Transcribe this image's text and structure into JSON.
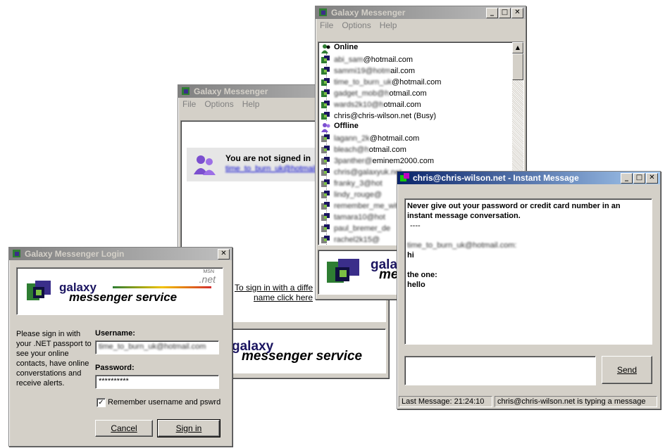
{
  "colors": {
    "title_active": "#0a246a",
    "title_inactive": "#808080",
    "window_face": "#d4d0c8",
    "logo_green": "#2e7d32",
    "logo_purple": "#3a2e8a",
    "link_blue": "#0000cc"
  },
  "main_window": {
    "title": "Galaxy Messenger",
    "menu": [
      "File",
      "Options",
      "Help"
    ],
    "not_signed_in_text": "You are not signed in",
    "signed_in_email_blurred": "time_to_burn_uk@hotmail.com",
    "sign_in_different_line1": "To sign in with a diffe",
    "sign_in_different_line2": "name click here",
    "logo_word1": "galaxy",
    "logo_word2": "messenger service"
  },
  "contacts_window": {
    "title": "Galaxy Messenger",
    "menu": [
      "File",
      "Options",
      "Help"
    ],
    "online_label": "Online",
    "offline_label": "Offline",
    "online": [
      {
        "pre": "abi_sam",
        "post": "@hotmail.com"
      },
      {
        "pre": "sammi19@hotm",
        "post": "ail.com"
      },
      {
        "pre": "time_to_burn_uk",
        "post": "@hotmail.com"
      },
      {
        "pre": "gadget_mob@h",
        "post": "otmail.com"
      },
      {
        "pre": "wards2k10@h",
        "post": "otmail.com"
      },
      {
        "pre": "",
        "post": "chris@chris-wilson.net (Busy)"
      }
    ],
    "offline": [
      {
        "pre": "lagann_2k",
        "post": "@hotmail.com"
      },
      {
        "pre": "bleach@h",
        "post": "otmail.com"
      },
      {
        "pre": "3panther@",
        "post": "eminem2000.com"
      },
      {
        "pre": "chris@galaxyuk.net",
        "post": ""
      },
      {
        "pre": "franky_3@hot",
        "post": ""
      },
      {
        "pre": "lindy_rouge@",
        "post": ""
      },
      {
        "pre": "remember_me_with",
        "post": ""
      },
      {
        "pre": "tamara10@hot",
        "post": ""
      },
      {
        "pre": "paul_bremer_de",
        "post": ""
      },
      {
        "pre": "rachel2k15@",
        "post": ""
      }
    ],
    "logo_word1": "gala",
    "logo_word2": "me"
  },
  "login_window": {
    "title": "Galaxy Messenger Login",
    "close": "✕",
    "net_badge": ".net",
    "net_small": "MSN",
    "logo_word1": "galaxy",
    "logo_word2": "messenger service",
    "info_text": "Please sign in with your .NET passport to see your online contacts,  have online converstations and receive alerts.",
    "username_label": "Username:",
    "username_value": "time_to_burn_uk@hotmail.com",
    "password_label": "Password:",
    "password_value": "**********",
    "remember_label": "Remember username and pswrd",
    "remember_checked": true,
    "cancel_label": "Cancel",
    "signin_label": "Sign in"
  },
  "im_window": {
    "title": "chris@chris-wilson.net - Instant Message",
    "warning": "Never give out your password or credit card number in an instant message conversation.",
    "separator": "----",
    "msg1_sender": "time_to_burn_uk@hotmail.com:",
    "msg1_text": "hi",
    "msg2_sender": "the one:",
    "msg2_text": "hello",
    "input_value": "",
    "send_label": "Send",
    "status_last": "Last Message: 21:24:10",
    "status_typing": "chris@chris-wilson.net is typing a message"
  }
}
